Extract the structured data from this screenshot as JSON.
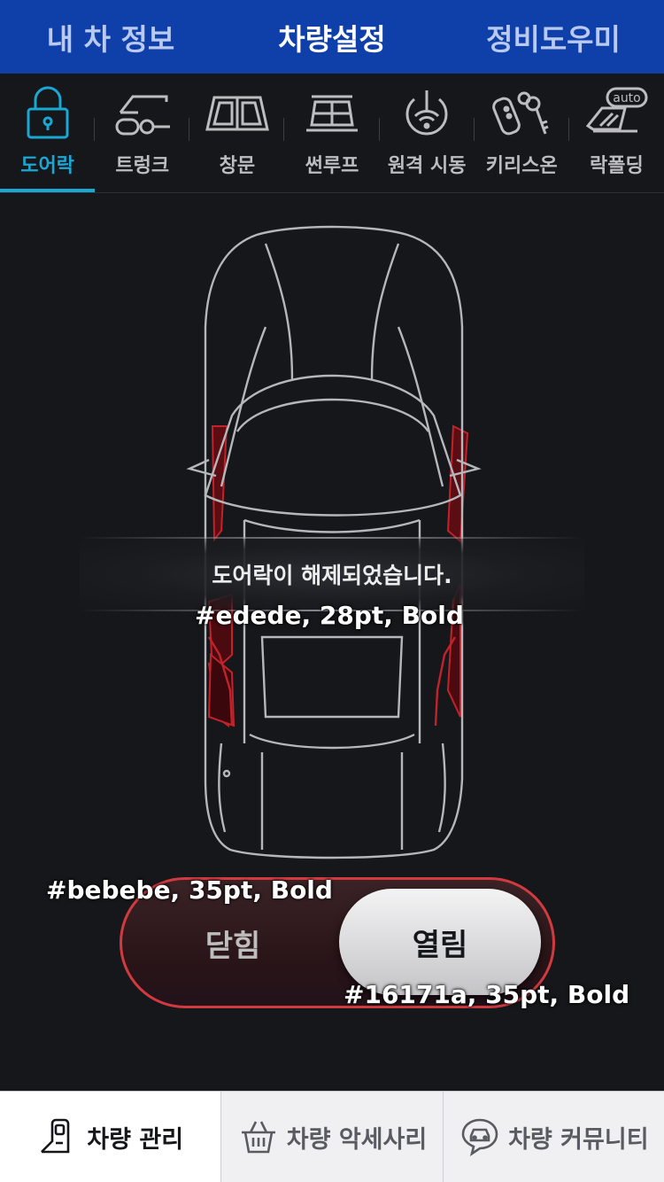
{
  "top_nav": {
    "tabs": [
      {
        "label": "내 차 정보"
      },
      {
        "label": "차량설정"
      },
      {
        "label": "정비도우미"
      }
    ],
    "active_index": 1
  },
  "feature_tabs": {
    "items": [
      {
        "label": "도어락",
        "icon": "door-lock-icon"
      },
      {
        "label": "트렁크",
        "icon": "trunk-icon"
      },
      {
        "label": "창문",
        "icon": "window-icon"
      },
      {
        "label": "썬루프",
        "icon": "sunroof-icon"
      },
      {
        "label": "원격 시동",
        "icon": "remote-start-icon"
      },
      {
        "label": "키리스온",
        "icon": "keyless-icon"
      },
      {
        "label": "락폴딩",
        "icon": "lock-folding-icon",
        "badge": "auto"
      }
    ],
    "active_index": 0,
    "active_color": "#19a7d3"
  },
  "toast": {
    "message": "도어락이 해제되었습니다.",
    "spec_note": "#edede, 28pt, Bold"
  },
  "lock_toggle": {
    "close_label": "닫힘",
    "open_label": "열림",
    "state": "open",
    "accent_color": "#d23a3f",
    "close_spec_note": "#bebebe, 35pt, Bold",
    "open_spec_note": "#16171a, 35pt, Bold"
  },
  "bottom_nav": {
    "tabs": [
      {
        "label": "차량 관리",
        "icon": "car-door-icon"
      },
      {
        "label": "차량 악세사리",
        "icon": "basket-icon"
      },
      {
        "label": "차량 커뮤니티",
        "icon": "car-chat-icon"
      }
    ],
    "active_index": 0
  },
  "colors": {
    "header_bg": "#0f3fa9",
    "screen_bg": "#16171a",
    "door_highlight": "#b0161c"
  }
}
